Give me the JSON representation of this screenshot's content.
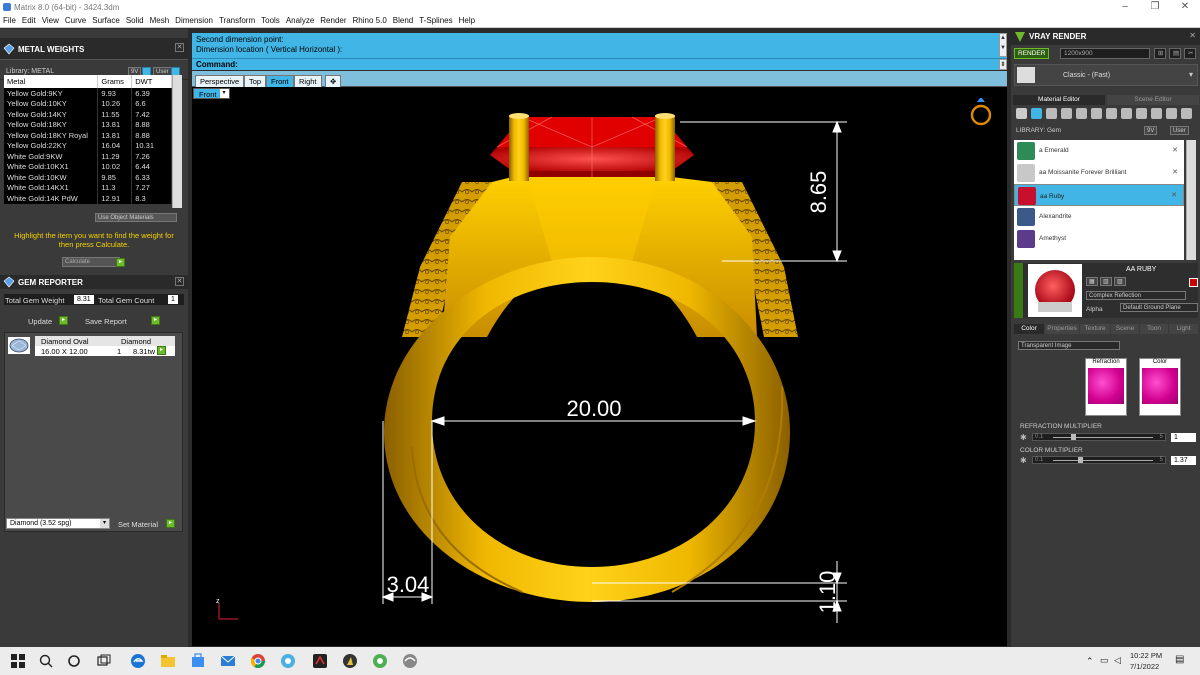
{
  "window": {
    "title": "Matrix 8.0 (64-bit) - 3424.3dm",
    "minimize": "–",
    "maximize": "❐",
    "close": "✕"
  },
  "menu": [
    "File",
    "Edit",
    "View",
    "Curve",
    "Surface",
    "Solid",
    "Mesh",
    "Dimension",
    "Transform",
    "Tools",
    "Analyze",
    "Render",
    "Rhino 5.0",
    "Blend",
    "T-Splines",
    "Help"
  ],
  "metal_weights": {
    "title": "METAL WEIGHTS",
    "library_label": "Library: METAL",
    "btn_9v": "9V",
    "btn_user": "User",
    "columns": [
      "Metal",
      "Grams",
      "DWT"
    ],
    "rows": [
      [
        "Yellow Gold:9KY",
        "9.93",
        "6.39"
      ],
      [
        "Yellow Gold:10KY",
        "10.26",
        "6.6"
      ],
      [
        "Yellow Gold:14KY",
        "11.55",
        "7.42"
      ],
      [
        "Yellow Gold:18KY",
        "13.81",
        "8.88"
      ],
      [
        "Yellow Gold:18KY Royal",
        "13.81",
        "8.88"
      ],
      [
        "Yellow Gold:22KY",
        "16.04",
        "10.31"
      ],
      [
        "White Gold:9KW",
        "11.29",
        "7.26"
      ],
      [
        "White Gold:10KX1",
        "10.02",
        "6.44"
      ],
      [
        "White Gold:10KW",
        "9.85",
        "6.33"
      ],
      [
        "White Gold:14KX1",
        "11.3",
        "7.27"
      ],
      [
        "White Gold:14K PdW",
        "12.91",
        "8.3"
      ]
    ],
    "use_object_materials": "Use Object Materials",
    "hint": "Highlight the item you want to find the weight for then press Calculate.",
    "calculate": "Calculate"
  },
  "gem_reporter": {
    "title": "GEM REPORTER",
    "total_weight_label": "Total Gem Weight",
    "total_weight_value": "8.31",
    "total_count_label": "Total Gem Count",
    "total_count_value": "1",
    "update": "Update",
    "save_report": "Save Report",
    "header": [
      "Diamond Oval",
      "Diamond"
    ],
    "row": [
      "16.00 X 12.00",
      "1",
      "8.31tw"
    ],
    "material_select": "Diamond    (3.52 spg)",
    "set_material": "Set Material"
  },
  "command": {
    "line1": "Second dimension point:",
    "line2": "Dimension location ( Vertical  Horizontal ):",
    "prompt": "Command:"
  },
  "view_tabs": [
    "Perspective",
    "Top",
    "Front",
    "Right"
  ],
  "active_tab": "Front",
  "viewport": {
    "label": "Front",
    "dims": {
      "top_height": "8.65",
      "inner_width": "20.00",
      "band_width": "3.04",
      "bottom_thickness": "1.10"
    },
    "axis_z": "z"
  },
  "vray": {
    "title": "VRAY RENDER",
    "render_btn": "RENDER",
    "resolution": "1200x900",
    "preset_label": "Classic - (Fast)",
    "tabs": [
      "Material Editor",
      "Scene Editor"
    ],
    "library_label": "LIBRARY: Gem",
    "btn_9v": "9V",
    "btn_user": "User",
    "materials": [
      {
        "name": "a Emerald",
        "color": "#2e8b57"
      },
      {
        "name": "aa Moissanite Forever Brilliant",
        "color": "#c8c8c8"
      },
      {
        "name": "aa Ruby",
        "color": "#c8102e"
      },
      {
        "name": "Alexandrite",
        "color": "#3b5a8a"
      },
      {
        "name": "Amethyst",
        "color": "#5b3b8a"
      }
    ],
    "selected_material": "aa Ruby",
    "current_name": "AA RUBY",
    "reflection": "Complex Reflection",
    "alpha": "Alpha",
    "ground": "Default Ground Plane",
    "subtabs": [
      "Color",
      "Properties",
      "Texture",
      "Scene",
      "Toon",
      "Light"
    ],
    "transparent": "Transparent Image",
    "refraction": "Refraction",
    "color": "Color",
    "refraction_multiplier": {
      "label": "REFRACTION MULTIPLIER",
      "min": "0.1",
      "max": "5",
      "value": "1"
    },
    "color_multiplier": {
      "label": "COLOR MULTIPLIER",
      "min": "0.1",
      "max": "5",
      "value": "1.37"
    }
  },
  "taskbar": {
    "time": "10:22 PM",
    "date": "7/1/2022"
  }
}
